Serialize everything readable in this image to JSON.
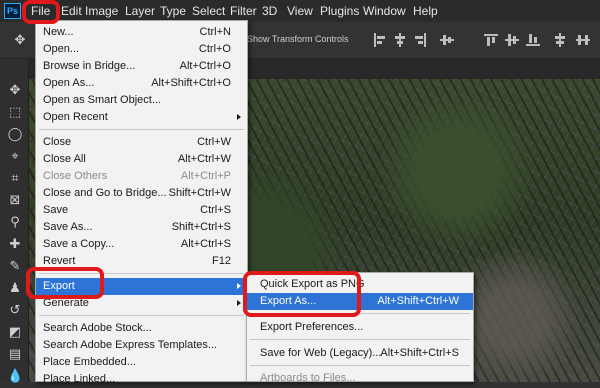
{
  "app": {
    "logo_text": "Ps"
  },
  "menubar": {
    "items": [
      "File",
      "Edit",
      "Image",
      "Layer",
      "Type",
      "Select",
      "Filter",
      "3D",
      "View",
      "Plugins",
      "Window",
      "Help"
    ]
  },
  "options_bar": {
    "show_transform_label": "Show Transform Controls"
  },
  "file_menu": {
    "items": [
      {
        "label": "New...",
        "shortcut": "Ctrl+N"
      },
      {
        "label": "Open...",
        "shortcut": "Ctrl+O"
      },
      {
        "label": "Browse in Bridge...",
        "shortcut": "Alt+Ctrl+O"
      },
      {
        "label": "Open As...",
        "shortcut": "Alt+Shift+Ctrl+O"
      },
      {
        "label": "Open as Smart Object...",
        "shortcut": ""
      },
      {
        "label": "Open Recent",
        "shortcut": ""
      },
      {
        "label": "Close",
        "shortcut": "Ctrl+W"
      },
      {
        "label": "Close All",
        "shortcut": "Alt+Ctrl+W"
      },
      {
        "label": "Close Others",
        "shortcut": "Alt+Ctrl+P"
      },
      {
        "label": "Close and Go to Bridge...",
        "shortcut": "Shift+Ctrl+W"
      },
      {
        "label": "Save",
        "shortcut": "Ctrl+S"
      },
      {
        "label": "Save As...",
        "shortcut": "Shift+Ctrl+S"
      },
      {
        "label": "Save a Copy...",
        "shortcut": "Alt+Ctrl+S"
      },
      {
        "label": "Revert",
        "shortcut": "F12"
      },
      {
        "label": "Export",
        "shortcut": ""
      },
      {
        "label": "Generate",
        "shortcut": ""
      },
      {
        "label": "Search Adobe Stock...",
        "shortcut": ""
      },
      {
        "label": "Search Adobe Express Templates...",
        "shortcut": ""
      },
      {
        "label": "Place Embedded...",
        "shortcut": ""
      },
      {
        "label": "Place Linked...",
        "shortcut": ""
      }
    ]
  },
  "export_menu": {
    "items": [
      {
        "label": "Quick Export as PNG",
        "shortcut": ""
      },
      {
        "label": "Export As...",
        "shortcut": "Alt+Shift+Ctrl+W"
      },
      {
        "label": "Export Preferences...",
        "shortcut": ""
      },
      {
        "label": "Save for Web (Legacy)...",
        "shortcut": "Alt+Shift+Ctrl+S"
      },
      {
        "label": "Artboards to Files...",
        "shortcut": ""
      }
    ]
  },
  "colors": {
    "selection": "#2e73d6",
    "highlight_ring": "#e01a1a"
  }
}
